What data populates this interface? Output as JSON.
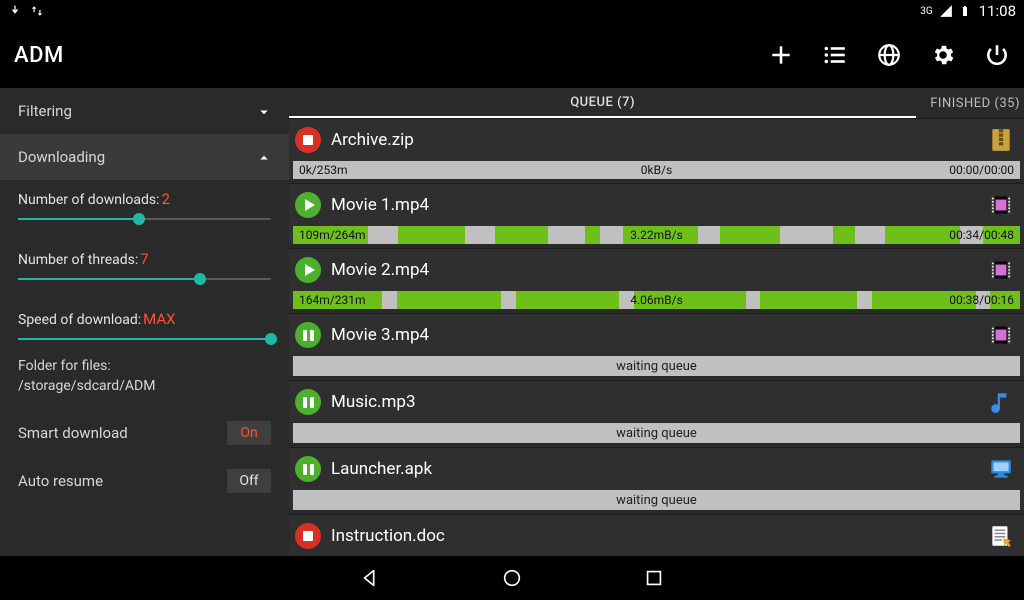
{
  "statusbar": {
    "signal_label": "3G",
    "clock": "11:08"
  },
  "header": {
    "title": "ADM"
  },
  "sidebar": {
    "filtering_label": "Filtering",
    "downloading_label": "Downloading",
    "settings": {
      "num_downloads_label": "Number of downloads:",
      "num_downloads_value": "2",
      "num_downloads_pct": 48,
      "num_threads_label": "Number of threads:",
      "num_threads_value": "7",
      "num_threads_pct": 72,
      "speed_label": "Speed of download:",
      "speed_value": "MAX",
      "speed_pct": 100,
      "folder_label": "Folder for files:",
      "folder_path": "/storage/sdcard/ADM",
      "smart_download_label": "Smart download",
      "smart_download_value": "On",
      "auto_resume_label": "Auto resume",
      "auto_resume_value": "Off"
    }
  },
  "tabs": {
    "queue": "QUEUE (7)",
    "finished": "FINISHED (35)"
  },
  "items": [
    {
      "name": "Archive.zip",
      "state": "stop",
      "type": "archive",
      "size": "0k/253m",
      "speed": "0kB/s",
      "time": "00:00/00:00",
      "segments": []
    },
    {
      "name": "Movie 1.mp4",
      "state": "play",
      "type": "video",
      "size": "109m/264m",
      "speed": "3.22mB/s",
      "time": "00:34/00:48",
      "segments": [
        10,
        4,
        9,
        4,
        7,
        5,
        2,
        3,
        10,
        3,
        8,
        7,
        3,
        4,
        10,
        3,
        5
      ]
    },
    {
      "name": "Movie 2.mp4",
      "state": "play",
      "type": "video",
      "size": "164m/231m",
      "speed": "4.06mB/s",
      "time": "00:38/00:16",
      "segments": [
        12,
        2,
        14,
        2,
        14,
        2,
        15,
        2,
        13,
        2,
        14,
        2,
        4
      ]
    },
    {
      "name": "Movie 3.mp4",
      "state": "pause",
      "type": "video",
      "waiting": "waiting queue"
    },
    {
      "name": "Music.mp3",
      "state": "pause",
      "type": "audio",
      "waiting": "waiting queue"
    },
    {
      "name": "Launcher.apk",
      "state": "pause",
      "type": "app",
      "waiting": "waiting queue"
    },
    {
      "name": "Instruction.doc",
      "state": "stop",
      "type": "doc"
    }
  ]
}
